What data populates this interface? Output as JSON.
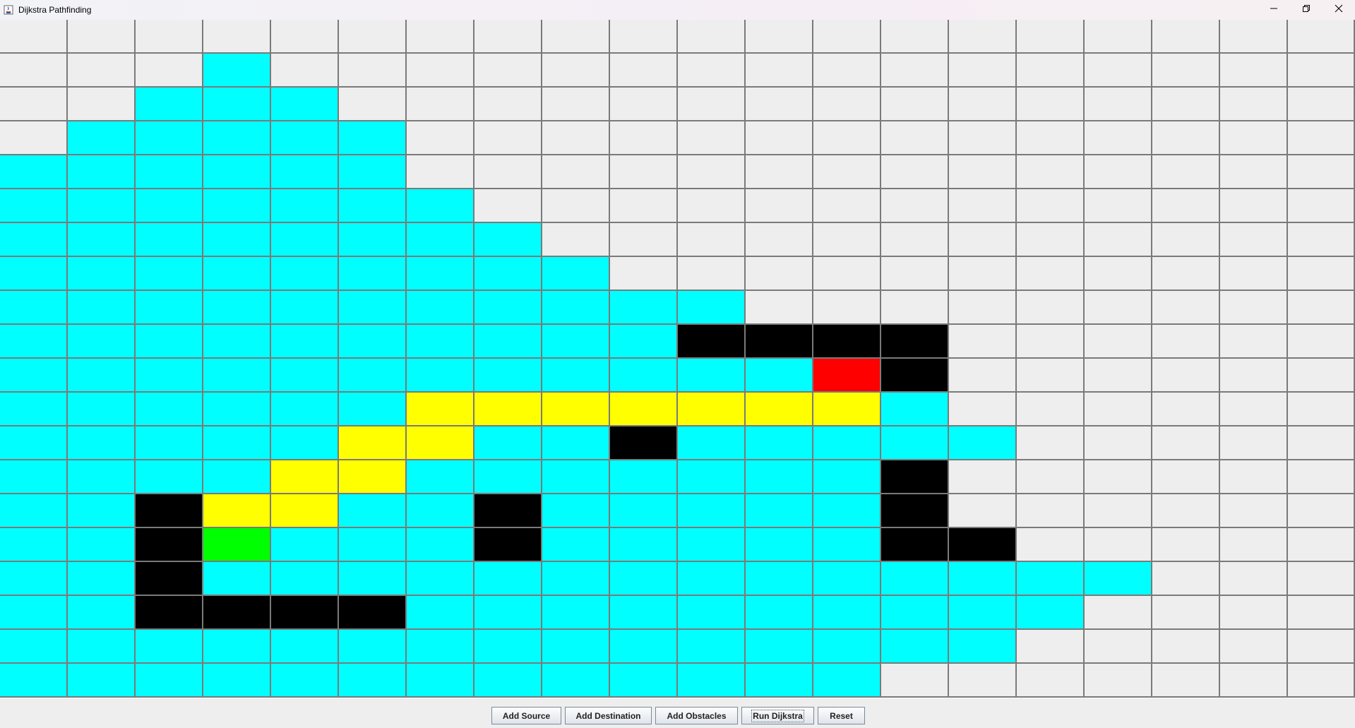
{
  "window": {
    "title": "Dijkstra Pathfinding",
    "app_icon": "java-icon",
    "controls": [
      "minimize-icon",
      "restore-icon",
      "close-icon"
    ]
  },
  "colors": {
    "empty": "#eeeeee",
    "visited": "#00ffff",
    "path": "#ffff00",
    "obstacle": "#000000",
    "source": "#00ff00",
    "destination": "#ff0000",
    "gridline": "#7a7a7a"
  },
  "grid": {
    "columns": 20,
    "rows": 20,
    "legend": {
      ".": "empty",
      "C": "visited",
      "Y": "path",
      "B": "obstacle",
      "G": "source",
      "R": "destination"
    },
    "cells": [
      "....................",
      "...C................",
      "..CCC...............",
      ".CCCCC..............",
      "CCCCCC..............",
      "CCCCCCC.............",
      "CCCCCCCC............",
      "CCCCCCCCC...........",
      "CCCCCCCCCCC.........",
      "CCCCCCCCCCBBBB......",
      "CCCCCCCCCCCCRB......",
      "CCCCCCYYYYYYYC......",
      "CCCCCYYCCBCCCCC.....",
      "CCCCYYCCCCCCCB......",
      "CCBYYCCBCCCCCB......",
      "CCBGCCCBCCCCCBB.....",
      "CCBCCCCCCCCCCCCCC...",
      "CCBBBBCCCCCCCCCC....",
      "CCCCCCCCCCCCCCC.....",
      "CCCCCCCCCCCCC......."
    ]
  },
  "buttons": [
    {
      "label": "Add Source",
      "focused": false
    },
    {
      "label": "Add Destination",
      "focused": false
    },
    {
      "label": "Add Obstacles",
      "focused": false
    },
    {
      "label": "Run Dijkstra",
      "focused": true
    },
    {
      "label": "Reset",
      "focused": false
    }
  ]
}
